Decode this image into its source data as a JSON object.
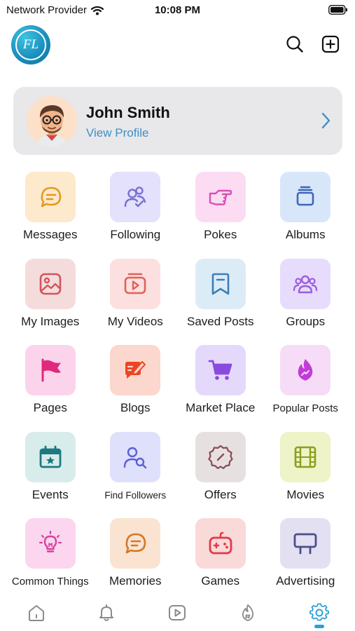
{
  "status_bar": {
    "carrier": "Network Provider",
    "time": "10:08 PM"
  },
  "header": {
    "logo_text": "FL",
    "icons": [
      "search-icon",
      "add-square-icon"
    ]
  },
  "profile": {
    "name": "John Smith",
    "link_label": "View Profile"
  },
  "menu": [
    {
      "label": "Messages",
      "icon": "message-bubble-icon",
      "bg": "#fde9cc",
      "fg": "#e39a1f"
    },
    {
      "label": "Following",
      "icon": "user-check-icon",
      "bg": "#e3e1fb",
      "fg": "#7b6fd6"
    },
    {
      "label": "Pokes",
      "icon": "pointing-hand-icon",
      "bg": "#fbdcf2",
      "fg": "#d84fb8"
    },
    {
      "label": "Albums",
      "icon": "album-stack-icon",
      "bg": "#d8e6fa",
      "fg": "#3c67b5"
    },
    {
      "label": "My Images",
      "icon": "image-icon",
      "bg": "#f5dcdc",
      "fg": "#d0555b"
    },
    {
      "label": "My Videos",
      "icon": "video-play-icon",
      "bg": "#fbe0df",
      "fg": "#e0625a"
    },
    {
      "label": "Saved Posts",
      "icon": "bookmark-icon",
      "bg": "#dcecf7",
      "fg": "#3c7fb6"
    },
    {
      "label": "Groups",
      "icon": "group-icon",
      "bg": "#e7dcfb",
      "fg": "#9a5de0"
    },
    {
      "label": "Pages",
      "icon": "flag-icon",
      "bg": "#fbd4ec",
      "fg": "#e0287c"
    },
    {
      "label": "Blogs",
      "icon": "blog-edit-icon",
      "bg": "#fbd7cd",
      "fg": "#ee4424"
    },
    {
      "label": "Market Place",
      "icon": "shopping-cart-icon",
      "bg": "#e4d9fa",
      "fg": "#8a4ae0"
    },
    {
      "label": "Popular Posts",
      "icon": "flame-icon",
      "bg": "#f6dcf6",
      "fg": "#c23bd8"
    },
    {
      "label": "Events",
      "icon": "calendar-star-icon",
      "bg": "#d8ecec",
      "fg": "#1b7a80"
    },
    {
      "label": "Find Followers",
      "icon": "user-search-icon",
      "bg": "#dfe0fb",
      "fg": "#5a60d6"
    },
    {
      "label": "Offers",
      "icon": "discount-badge-icon",
      "bg": "#e7e0e0",
      "fg": "#8a4a55"
    },
    {
      "label": "Movies",
      "icon": "film-icon",
      "bg": "#eef3c8",
      "fg": "#8aa01c"
    },
    {
      "label": "Common Things",
      "icon": "lightbulb-icon",
      "bg": "#fbd6ee",
      "fg": "#d8409e"
    },
    {
      "label": "Memories",
      "icon": "message-bubble-icon",
      "bg": "#fae3d0",
      "fg": "#d2782a"
    },
    {
      "label": "Games",
      "icon": "gamepad-icon",
      "bg": "#fad9d9",
      "fg": "#e03b46"
    },
    {
      "label": "Advertising",
      "icon": "billboard-icon",
      "bg": "#e2e0f1",
      "fg": "#4a4e8c"
    }
  ],
  "bottom_nav": {
    "items": [
      "home-icon",
      "bell-icon",
      "video-icon",
      "trending-hashtag-icon",
      "settings-gear-icon"
    ],
    "active": "settings-gear-icon",
    "accent": "#2a9fd8"
  }
}
